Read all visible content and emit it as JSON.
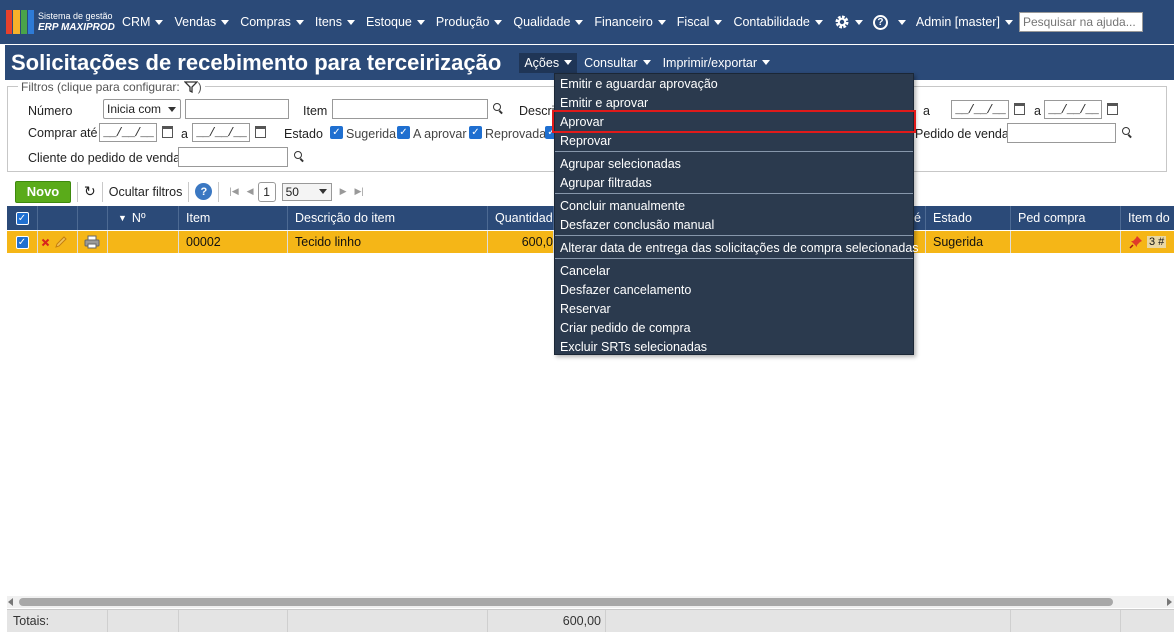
{
  "app": {
    "logo_line1": "Sistema de gestão",
    "logo_line2": "ERP MAXIPROD",
    "logo_colors": [
      "#e8412c",
      "#f7b12a",
      "#4aa34a",
      "#2e7bd6"
    ]
  },
  "nav": {
    "items": [
      "CRM",
      "Vendas",
      "Compras",
      "Itens",
      "Estoque",
      "Produção",
      "Qualidade",
      "Financeiro",
      "Fiscal",
      "Contabilidade"
    ],
    "settings_icon": "gear-icon",
    "help_icon": "question-circle-icon",
    "help_mark": "?",
    "user": "Admin [master]",
    "search_placeholder": "Pesquisar na ajuda..."
  },
  "page": {
    "title": "Solicitações de recebimento para terceirização",
    "menus": [
      "Ações",
      "Consultar",
      "Imprimir/exportar"
    ]
  },
  "filters": {
    "legend": "Filtros (clique para configurar:",
    "legend_close": ")",
    "numero_label": "Número",
    "numero_mode": "Inicia com",
    "item_label": "Item",
    "descricao_label": "Descri",
    "date_right_label": "a",
    "date_right_a": "a",
    "comprar_ate_label": "Comprar até",
    "date_a": "a",
    "estado_label": "Estado",
    "estados": [
      "Sugerida",
      "A aprovar",
      "Reprovada"
    ],
    "pedido_venda_label": "Pedido de venda",
    "cliente_label": "Cliente do pedido de venda",
    "date_placeholder": "__/__/__",
    "check_mark": "✓"
  },
  "toolbar": {
    "new_label": "Novo",
    "refresh_icon": "↻",
    "hide_filters_label": "Ocultar filtros",
    "help_mark": "?",
    "first_icon": "|◀",
    "prev_icon": "◀",
    "page": "1",
    "per_page": "50",
    "next_icon": "▶",
    "last_icon": "▶|"
  },
  "grid": {
    "headers": {
      "num": "Nº",
      "item": "Item",
      "descricao": "Descrição do item",
      "quantidade": "Quantidade",
      "partial": "é",
      "estado": "Estado",
      "ped_compra": "Ped compra",
      "item_do": "Item do"
    },
    "sort_icon": "▼",
    "row": {
      "item": "00002",
      "descricao": "Tecido linho",
      "quantidade": "600,0",
      "estado": "Sugerida",
      "item_do_count": "3 #"
    }
  },
  "totals": {
    "label": "Totais:",
    "quantidade": "600,00"
  },
  "actions_menu": {
    "items": [
      "Emitir e aguardar aprovação",
      "Emitir e aprovar",
      "Aprovar",
      "Reprovar",
      "Agrupar selecionadas",
      "Agrupar filtradas",
      "Concluir manualmente",
      "Desfazer conclusão manual",
      "Alterar data de entrega das solicitações de compra selecionadas",
      "Cancelar",
      "Desfazer cancelamento",
      "Reservar",
      "Criar pedido de compra",
      "Excluir SRTs selecionadas"
    ],
    "highlight_color": "#e01a1a"
  }
}
